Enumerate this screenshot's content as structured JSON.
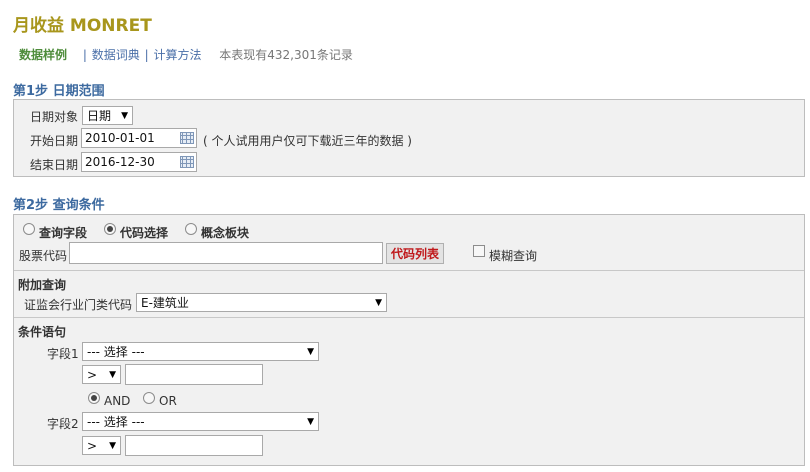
{
  "header": {
    "title": "月收益  MONRET"
  },
  "tabs": {
    "sample": "数据样例",
    "sep1": "|",
    "dictionary": "数据词典",
    "sep2": "|",
    "calc": "计算方法",
    "record_count": "本表现有432,301条记录"
  },
  "step1": {
    "title": "第1步 日期范围",
    "date_object_label": "日期对象",
    "date_object_value": "日期",
    "start_label": "开始日期",
    "start_value": "2010-01-01",
    "note": "( 个人试用用户仅可下载近三年的数据 )",
    "end_label": "结束日期",
    "end_value": "2016-12-30"
  },
  "step2": {
    "title": "第2步 查询条件",
    "mode_options": [
      {
        "label": "查询字段",
        "checked": false
      },
      {
        "label": "代码选择",
        "checked": true
      },
      {
        "label": "概念板块",
        "checked": false
      }
    ],
    "stock_code_label": "股票代码",
    "stock_code_value": "",
    "code_list_button": "代码列表",
    "fuzzy_label": "模糊查询",
    "fuzzy_checked": false,
    "extra_title": "附加查询",
    "industry_label": "证监会行业门类代码",
    "industry_value": "E-建筑业",
    "cond_title": "条件语句",
    "field1_label": "字段1",
    "field1_value": "--- 选择 ---",
    "op1_value": ">",
    "value1": "",
    "logic_options": [
      {
        "label": "AND",
        "checked": true
      },
      {
        "label": "OR",
        "checked": false
      }
    ],
    "field2_label": "字段2",
    "field2_value": "--- 选择 ---",
    "op2_value": ">",
    "value2": ""
  },
  "icons": {
    "calendar": "calendar-icon",
    "dropdown": "▼"
  },
  "colors": {
    "title": "#a8961c",
    "step": "#3d6aa0",
    "active_tab": "#4f8d3c",
    "link": "#4a6fa8",
    "button_text": "#c0181b",
    "panel_bg": "#f1f1f1"
  }
}
